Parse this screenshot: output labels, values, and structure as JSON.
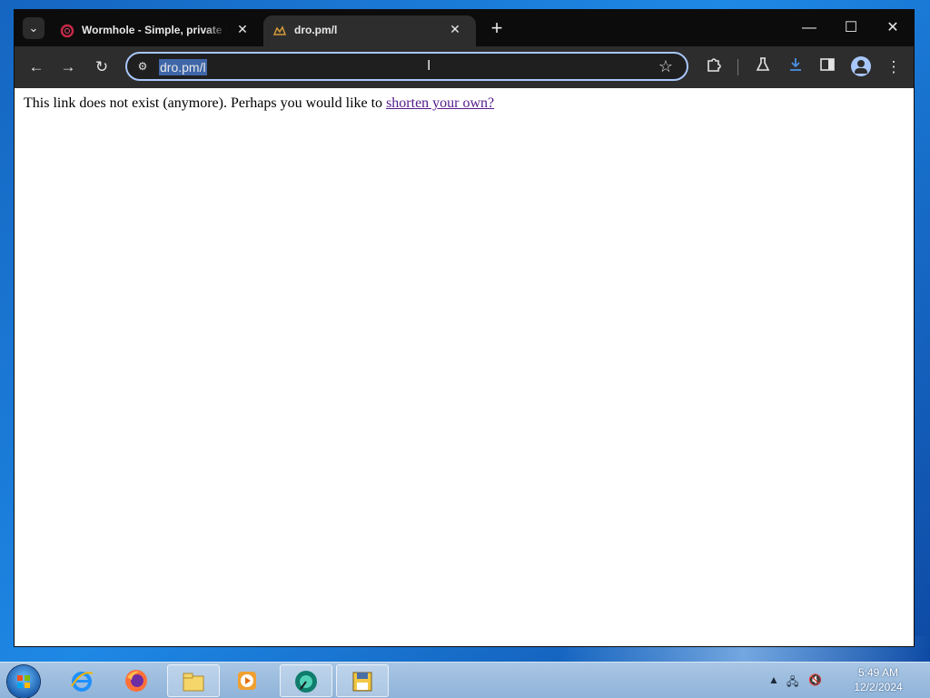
{
  "browser": {
    "tabs": [
      {
        "title": "Wormhole - Simple, private fil",
        "active": false,
        "favicon": "wormhole-ring-icon"
      },
      {
        "title": "dro.pm/l",
        "active": true,
        "favicon": "dro-pm-favicon"
      }
    ],
    "omnibox": {
      "url": "dro.pm/l"
    },
    "window_controls": {
      "minimize": "—",
      "maximize": "☐",
      "close": "✕"
    }
  },
  "page": {
    "message_prefix": "This link does not exist (anymore). Perhaps you would like to ",
    "link_text": "shorten your own?"
  },
  "taskbar": {
    "apps": [
      "internet-explorer-icon",
      "firefox-icon",
      "file-explorer-icon",
      "media-player-icon",
      "browser-app-icon",
      "save-disk-icon"
    ],
    "clock": {
      "time": "5:49 AM",
      "date": "12/2/2024"
    }
  },
  "colors": {
    "tabstrip": "#0c0c0c",
    "toolbar": "#2d2d2d",
    "omnibox_focus": "#a8c7fa",
    "link_visited": "#551a8b",
    "desktop": "#1e88e5"
  }
}
